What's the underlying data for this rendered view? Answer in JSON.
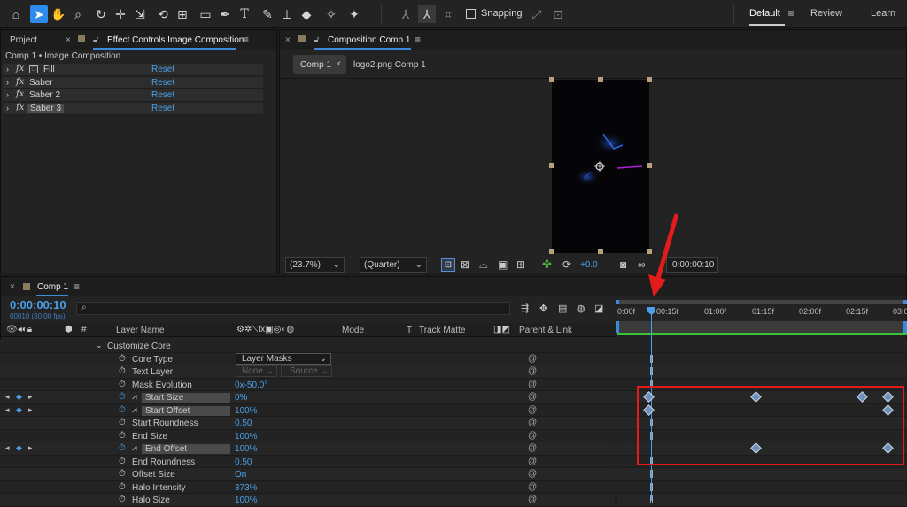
{
  "toolbar": {
    "snapping_label": "Snapping",
    "workspaces": [
      "Default",
      "Review",
      "Learn"
    ]
  },
  "project_tab": "Project",
  "effect_controls": {
    "tab_label": "Effect Controls Image Composition",
    "subtitle": "Comp 1 • Image Composition",
    "reset_label": "Reset",
    "effects": [
      "Fill",
      "Saber",
      "Saber 2",
      "Saber 3"
    ]
  },
  "composition": {
    "tab_label": "Composition Comp 1",
    "breadcrumbs": [
      "Comp 1",
      "logo2.png Comp 1"
    ],
    "zoom": "(23.7%)",
    "quality": "(Quarter)",
    "exposure": "+0.0",
    "timecode": "0:00:00:10"
  },
  "timeline": {
    "tab_label": "Comp 1",
    "timecode": "0:00:00:10",
    "frames": "00010 (30.00 fps)",
    "columns": {
      "layer_name": "Layer Name",
      "mode": "Mode",
      "t": "T",
      "track_matte": "Track Matte",
      "parent_link": "Parent & Link"
    },
    "ruler_labels": [
      "0:00f",
      "00:15f",
      "01:00f",
      "01:15f",
      "02:00f",
      "02:15f",
      "03:0"
    ],
    "group_label": "Customize Core",
    "rows": [
      {
        "name": "Core Type",
        "value": "Layer Masks",
        "type": "dropdown"
      },
      {
        "name": "Text Layer",
        "value": "None",
        "value2": "Source",
        "type": "dimdrop"
      },
      {
        "name": "Mask Evolution",
        "value": "0x-50.0°"
      },
      {
        "name": "Start Size",
        "value": "0%",
        "keyed": true
      },
      {
        "name": "Start Offset",
        "value": "100%",
        "keyed": true
      },
      {
        "name": "Start Roundness",
        "value": "0.50"
      },
      {
        "name": "End Size",
        "value": "100%"
      },
      {
        "name": "End Offset",
        "value": "100%",
        "keyed": true
      },
      {
        "name": "End Roundness",
        "value": "0.50"
      },
      {
        "name": "Offset Size",
        "value": "On"
      },
      {
        "name": "Halo Intensity",
        "value": "373%"
      },
      {
        "name": "Halo Size",
        "value": "100%"
      }
    ]
  },
  "colors": {
    "accent": "#2d8ceb",
    "value_blue": "#4a9fe8",
    "annotation_red": "#e31b1b",
    "work_area_green": "#39c339"
  }
}
